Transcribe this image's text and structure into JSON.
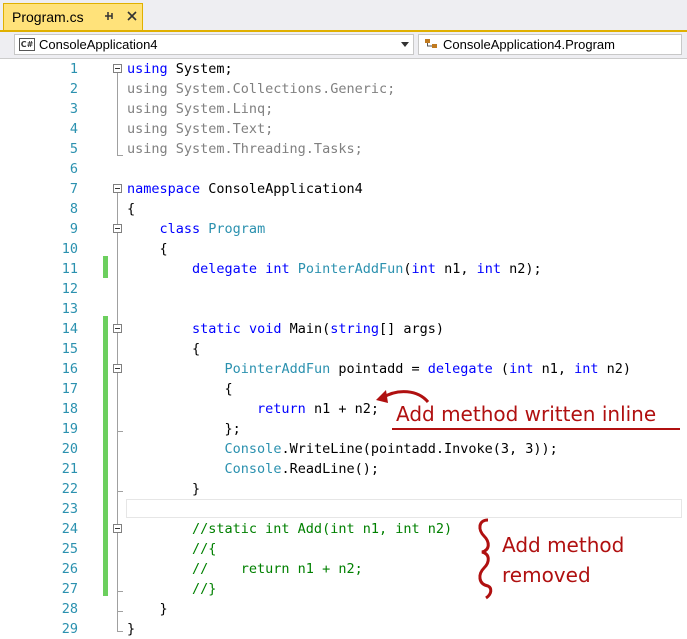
{
  "tab": {
    "title": "Program.cs"
  },
  "navbar": {
    "project_combo": "ConsoleApplication4",
    "member_combo": "ConsoleApplication4.Program"
  },
  "lines": [
    {
      "n": "1"
    },
    {
      "n": "2"
    },
    {
      "n": "3"
    },
    {
      "n": "4"
    },
    {
      "n": "5"
    },
    {
      "n": "6"
    },
    {
      "n": "7"
    },
    {
      "n": "8"
    },
    {
      "n": "9"
    },
    {
      "n": "10"
    },
    {
      "n": "11"
    },
    {
      "n": "12"
    },
    {
      "n": "13"
    },
    {
      "n": "14"
    },
    {
      "n": "15"
    },
    {
      "n": "16"
    },
    {
      "n": "17"
    },
    {
      "n": "18"
    },
    {
      "n": "19"
    },
    {
      "n": "20"
    },
    {
      "n": "21"
    },
    {
      "n": "22"
    },
    {
      "n": "23"
    },
    {
      "n": "24"
    },
    {
      "n": "25"
    },
    {
      "n": "26"
    },
    {
      "n": "27"
    },
    {
      "n": "28"
    },
    {
      "n": "29"
    }
  ],
  "code": {
    "l1_kw": "using",
    "l1_rest": " System;",
    "l2": "using System.Collections.Generic;",
    "l3": "using System.Linq;",
    "l4": "using System.Text;",
    "l5": "using System.Threading.Tasks;",
    "l7_kw": "namespace",
    "l7_rest": " ConsoleApplication4",
    "l8": "{",
    "l9_indent": "    ",
    "l9_kw": "class",
    "l9_sp": " ",
    "l9_ty": "Program",
    "l10": "    {",
    "l11_indent": "        ",
    "l11_kw1": "delegate",
    "l11_sp": " ",
    "l11_kw2": "int",
    "l11_sp2": " ",
    "l11_ty": "PointerAddFun",
    "l11_p1": "(",
    "l11_kw3": "int",
    "l11_p2": " n1, ",
    "l11_kw4": "int",
    "l11_p3": " n2);",
    "l14_indent": "        ",
    "l14_kw1": "static",
    "l14_sp": " ",
    "l14_kw2": "void",
    "l14_p1": " Main(",
    "l14_kw3": "string",
    "l14_p2": "[] args)",
    "l15": "        {",
    "l16_indent": "            ",
    "l16_ty": "PointerAddFun",
    "l16_p1": " pointadd = ",
    "l16_kw1": "delegate",
    "l16_p2": " (",
    "l16_kw2": "int",
    "l16_p3": " n1, ",
    "l16_kw3": "int",
    "l16_p4": " n2)",
    "l17": "            {",
    "l18_indent": "                ",
    "l18_kw": "return",
    "l18_rest": " n1 + n2;",
    "l19": "            };",
    "l20_indent": "            ",
    "l20_ty": "Console",
    "l20_rest": ".WriteLine(pointadd.Invoke(3, 3));",
    "l21_indent": "            ",
    "l21_ty": "Console",
    "l21_rest": ".ReadLine();",
    "l22": "        }",
    "l24": "        //static int Add(int n1, int n2)",
    "l25": "        //{",
    "l26": "        //    return n1 + n2;",
    "l27": "        //}",
    "l28": "    }",
    "l29": "}"
  },
  "annotations": {
    "inline": "Add method written inline",
    "removed_line1": "Add method",
    "removed_line2": "removed"
  },
  "colors": {
    "keyword": "#0000ff",
    "type": "#2b91af",
    "comment": "#008000",
    "annotation": "#b01010",
    "change_bar": "#6ccf5e",
    "tab_active": "#ffe27a"
  }
}
